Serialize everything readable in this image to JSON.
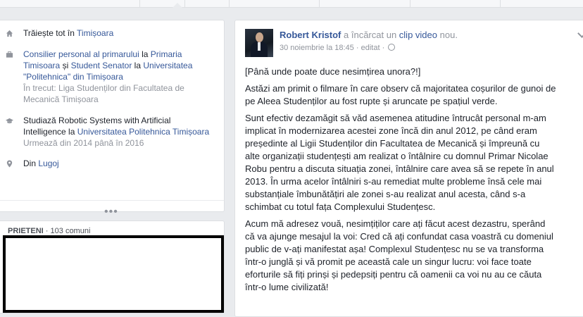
{
  "intro": {
    "lives": {
      "prefix": "Trăiește tot în",
      "place": "Timișoara"
    },
    "work": {
      "line1_link1": "Consilier personal al primarului",
      "line1_mid": "la",
      "line1_link2": "Primaria",
      "line2_link1": "Timisoara",
      "line2_mid1": "și",
      "line2_link2": "Student Senator",
      "line2_mid2": "la",
      "line2_link3": "Universitatea",
      "line3_link": "\"Politehnica\"",
      "line3_rest": "din Timișoara",
      "past_prefix": "În trecut:",
      "past_line1": "Liga Studenților din Facultatea de",
      "past_line2": "Mecanică Timișoara"
    },
    "study": {
      "line1": "Studiază Robotic Systems with Artificial",
      "line2_prefix": "Intelligence la",
      "line2_link": "Universitatea Politehnica Timișoara",
      "line3": "Urmează din 2014 până în 2016"
    },
    "from": {
      "prefix": "Din",
      "place": "Lugoj"
    },
    "more": "•••"
  },
  "friends": {
    "title": "PRIETENI",
    "sep": "·",
    "count": "103 comuni"
  },
  "post": {
    "author": "Robert Kristof",
    "action_prefix": "a încărcat un",
    "action_link": "clip video",
    "action_suffix": "nou.",
    "date": "30 noiembrie la 18:45",
    "dot": "·",
    "edited": "editat",
    "paragraphs": [
      [
        "[Până unde poate duce nesimțirea unora?!]"
      ],
      [
        "Astăzi am primit o filmare în care observ că majoritatea coșurilor de gunoi de",
        "pe Aleea Studenților au fost rupte și aruncate pe spațiul verde."
      ],
      [
        "Sunt efectiv dezamăgit să văd asemenea atitudine întrucât personal m-am",
        "implicat în modernizarea acestei zone încă din anul 2012, pe când eram",
        "președinte al Ligii Studenților din Facultatea de Mecanică și împreună cu",
        "alte organizații studențești am realizat o întâlnire cu domnul Primar Nicolae",
        "Robu pentru a discuta situația zonei, întâlnire care avea să se repete în anul",
        "2013. În urma acelor întâlniri s-au remediat multe probleme însă cele mai",
        "substanțiale îmbunătățiri ale zonei s-au realizat anul acesta, când s-a",
        "schimbat cu totul fața Complexului Studențesc."
      ],
      [
        "Acum mă adresez vouă, nesimțiților care ați făcut acest dezastru, sperând",
        "că va ajunge mesajul la voi: Cred că ați confundat casa voastră cu domeniul",
        "public de v-ați manifestat așa! Complexul Studențesc nu se va transforma",
        "într-o junglă și vă promit pe această cale un singur lucru: voi face toate",
        "eforturile să fiți prinși și pedepsiți pentru că oamenii ca voi nu au ce căuta",
        "într-o lume civilizată!"
      ]
    ]
  },
  "colors": {
    "link": "#365899",
    "muted": "#90949c",
    "text": "#1d2129",
    "background": "#e9ebee"
  },
  "icons": {
    "lives": "home-icon",
    "work": "briefcase-icon",
    "study": "graduation-cap-icon",
    "from": "location-pin-icon",
    "privacy": "globe-icon",
    "menu": "chevron-down-icon"
  }
}
